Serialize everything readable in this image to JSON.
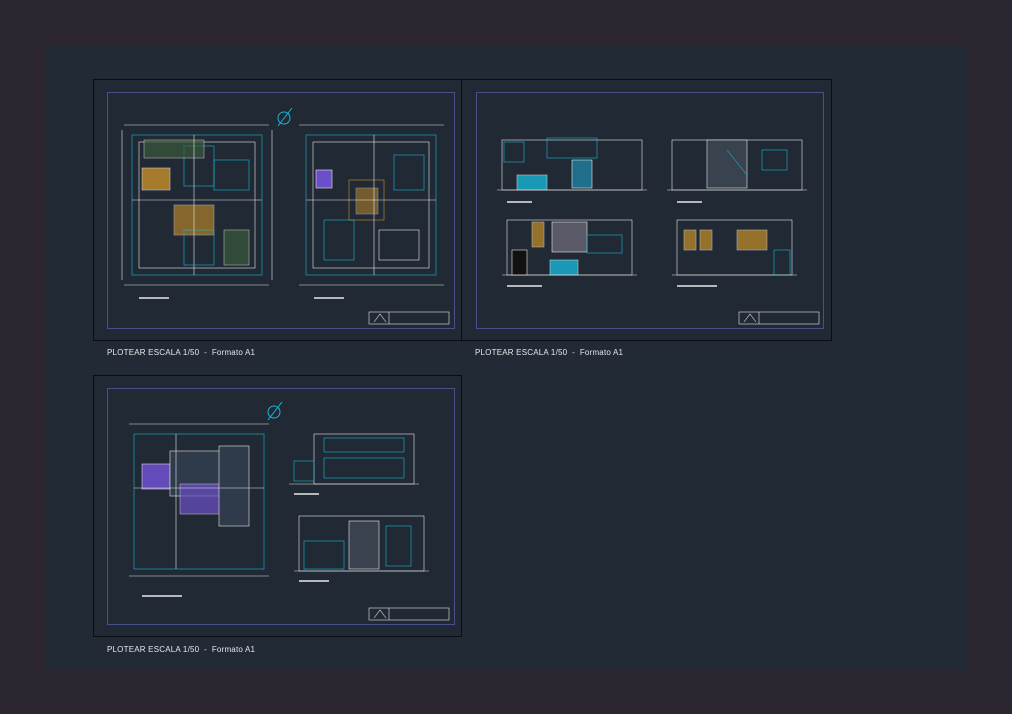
{
  "sheets": [
    {
      "caption": "PLOTEAR ESCALA 1/50  -  Formato A1"
    },
    {
      "caption": "PLOTEAR ESCALA 1/50  -  Formato A1"
    },
    {
      "caption": "PLOTEAR ESCALA 1/50  -  Formato A1"
    }
  ],
  "colors": {
    "background": "#2b2630",
    "modelspace": "#222a36",
    "sheet_frame": "#4a4f8a",
    "cyan": "#19b6d6",
    "white": "#e8e8e8",
    "yellow": "#d6c84a",
    "green": "#4aa84a",
    "purple": "#6b4fc8",
    "orange": "#c8902a"
  }
}
